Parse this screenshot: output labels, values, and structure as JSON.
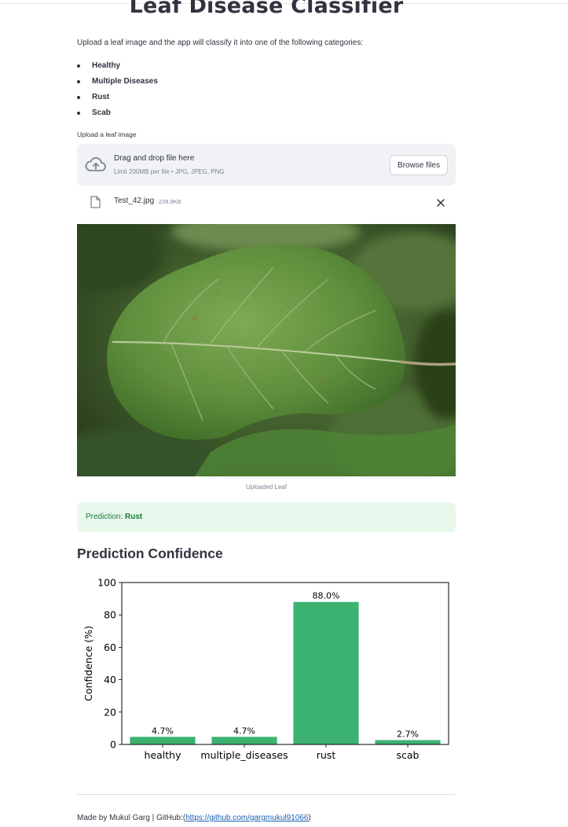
{
  "header": {
    "title": "Leaf Disease Classifier"
  },
  "intro": "Upload a leaf image and the app will classify it into one of the following categories:",
  "categories": [
    "Healthy",
    "Multiple Diseases",
    "Rust",
    "Scab"
  ],
  "uploader": {
    "label": "Upload a leaf image",
    "drop_text": "Drag and drop file here",
    "limit_text": "Limit 200MB per file • JPG, JPEG, PNG",
    "browse_label": "Browse files",
    "file_name": "Test_42.jpg",
    "file_size": "228.9KB",
    "icons": {
      "upload": "cloud-upload-icon",
      "file": "file-icon",
      "remove": "close-icon"
    }
  },
  "image": {
    "caption": "Uploaded Leaf"
  },
  "prediction": {
    "prefix": "Prediction: ",
    "label": "Rust"
  },
  "section_title": "Prediction Confidence",
  "colors": {
    "bar": "#3cb371",
    "success_bg": "#e8f8ed",
    "success_text": "#1c7a3b",
    "link": "#1a5fb4"
  },
  "chart_data": {
    "type": "bar",
    "categories": [
      "healthy",
      "multiple_diseases",
      "rust",
      "scab"
    ],
    "values": [
      4.7,
      4.7,
      88.0,
      2.7
    ],
    "data_labels": [
      "4.7%",
      "4.7%",
      "88.0%",
      "2.7%"
    ],
    "ylabel": "Confidence (%)",
    "xlabel": "",
    "ylim": [
      0,
      100
    ],
    "yticks": [
      "0",
      "20",
      "40",
      "60",
      "80",
      "100"
    ],
    "grid": false
  },
  "footer": {
    "text": "Made by Mukul Garg | GitHub:(",
    "link": "https://github.com/gargmukul91066",
    "close": ")"
  }
}
